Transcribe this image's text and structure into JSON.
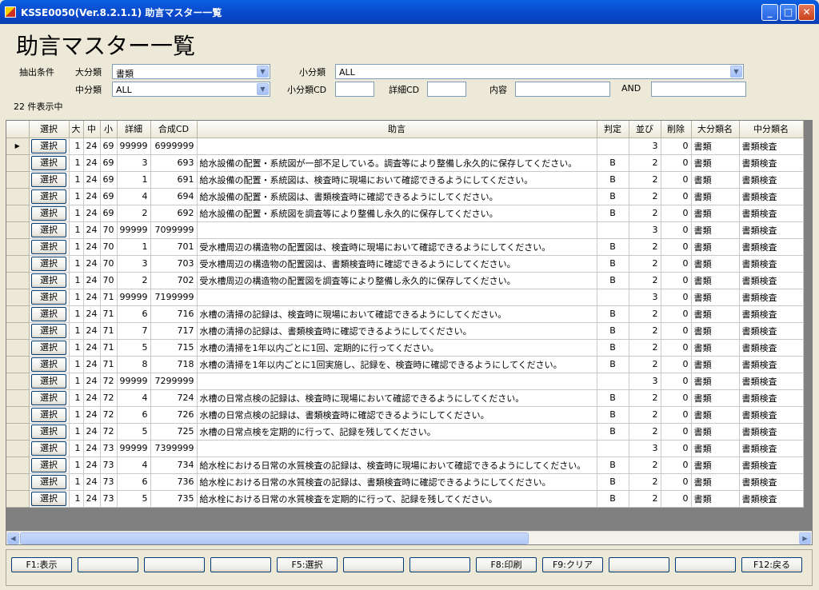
{
  "window": {
    "title": "KSSE0050(Ver.8.2.1.1) 助言マスター一覧"
  },
  "page_title": "助言マスター一覧",
  "filter": {
    "section_label": "抽出条件",
    "large_label": "大分類",
    "large_value": "書類",
    "small_label": "小分類",
    "small_value": "ALL",
    "middle_label": "中分類",
    "middle_value": "ALL",
    "small_cd_label": "小分類CD",
    "small_cd_value": "",
    "detail_cd_label": "詳細CD",
    "detail_cd_value": "",
    "content_label": "内容",
    "content_value": "",
    "and_label": "AND",
    "and_value": ""
  },
  "count_text": "22 件表示中",
  "table": {
    "columns": [
      "選択",
      "大",
      "中",
      "小",
      "詳細",
      "合成CD",
      "助言",
      "判定",
      "並び",
      "削除",
      "大分類名",
      "中分類名"
    ],
    "select_label": "選択",
    "rows": [
      [
        "1",
        "24",
        "69",
        "99999",
        "6999999",
        "",
        "",
        "3",
        "0",
        "書類",
        "書類検査"
      ],
      [
        "1",
        "24",
        "69",
        "3",
        "693",
        "給水設備の配置・系統図が一部不足している。調査等により整備し永久的に保存してください。",
        "B",
        "2",
        "0",
        "書類",
        "書類検査"
      ],
      [
        "1",
        "24",
        "69",
        "1",
        "691",
        "給水設備の配置・系統図は、検査時に現場において確認できるようにしてください。",
        "B",
        "2",
        "0",
        "書類",
        "書類検査"
      ],
      [
        "1",
        "24",
        "69",
        "4",
        "694",
        "給水設備の配置・系統図は、書類検査時に確認できるようにしてください。",
        "B",
        "2",
        "0",
        "書類",
        "書類検査"
      ],
      [
        "1",
        "24",
        "69",
        "2",
        "692",
        "給水設備の配置・系統図を調査等により整備し永久的に保存してください。",
        "B",
        "2",
        "0",
        "書類",
        "書類検査"
      ],
      [
        "1",
        "24",
        "70",
        "99999",
        "7099999",
        "",
        "",
        "3",
        "0",
        "書類",
        "書類検査"
      ],
      [
        "1",
        "24",
        "70",
        "1",
        "701",
        "受水槽周辺の構造物の配置図は、検査時に現場において確認できるようにしてください。",
        "B",
        "2",
        "0",
        "書類",
        "書類検査"
      ],
      [
        "1",
        "24",
        "70",
        "3",
        "703",
        "受水槽周辺の構造物の配置図は、書類検査時に確認できるようにしてください。",
        "B",
        "2",
        "0",
        "書類",
        "書類検査"
      ],
      [
        "1",
        "24",
        "70",
        "2",
        "702",
        "受水槽周辺の構造物の配置図を調査等により整備し永久的に保存してください。",
        "B",
        "2",
        "0",
        "書類",
        "書類検査"
      ],
      [
        "1",
        "24",
        "71",
        "99999",
        "7199999",
        "",
        "",
        "3",
        "0",
        "書類",
        "書類検査"
      ],
      [
        "1",
        "24",
        "71",
        "6",
        "716",
        "水槽の清掃の記録は、検査時に現場において確認できるようにしてください。",
        "B",
        "2",
        "0",
        "書類",
        "書類検査"
      ],
      [
        "1",
        "24",
        "71",
        "7",
        "717",
        "水槽の清掃の記録は、書類検査時に確認できるようにしてください。",
        "B",
        "2",
        "0",
        "書類",
        "書類検査"
      ],
      [
        "1",
        "24",
        "71",
        "5",
        "715",
        "水槽の清掃を1年以内ごとに1回、定期的に行ってください。",
        "B",
        "2",
        "0",
        "書類",
        "書類検査"
      ],
      [
        "1",
        "24",
        "71",
        "8",
        "718",
        "水槽の清掃を1年以内ごとに1回実施し、記録を、検査時に確認できるようにしてください。",
        "B",
        "2",
        "0",
        "書類",
        "書類検査"
      ],
      [
        "1",
        "24",
        "72",
        "99999",
        "7299999",
        "",
        "",
        "3",
        "0",
        "書類",
        "書類検査"
      ],
      [
        "1",
        "24",
        "72",
        "4",
        "724",
        "水槽の日常点検の記録は、検査時に現場において確認できるようにしてください。",
        "B",
        "2",
        "0",
        "書類",
        "書類検査"
      ],
      [
        "1",
        "24",
        "72",
        "6",
        "726",
        "水槽の日常点検の記録は、書類検査時に確認できるようにしてください。",
        "B",
        "2",
        "0",
        "書類",
        "書類検査"
      ],
      [
        "1",
        "24",
        "72",
        "5",
        "725",
        "水槽の日常点検を定期的に行って、記録を残してください。",
        "B",
        "2",
        "0",
        "書類",
        "書類検査"
      ],
      [
        "1",
        "24",
        "73",
        "99999",
        "7399999",
        "",
        "",
        "3",
        "0",
        "書類",
        "書類検査"
      ],
      [
        "1",
        "24",
        "73",
        "4",
        "734",
        "給水栓における日常の水質検査の記録は、検査時に現場において確認できるようにしてください。",
        "B",
        "2",
        "0",
        "書類",
        "書類検査"
      ],
      [
        "1",
        "24",
        "73",
        "6",
        "736",
        "給水栓における日常の水質検査の記録は、書類検査時に確認できるようにしてください。",
        "B",
        "2",
        "0",
        "書類",
        "書類検査"
      ],
      [
        "1",
        "24",
        "73",
        "5",
        "735",
        "給水栓における日常の水質検査を定期的に行って、記録を残してください。",
        "B",
        "2",
        "0",
        "書類",
        "書類検査"
      ]
    ]
  },
  "fkeys": [
    "F1:表示",
    "",
    "",
    "",
    "F5:選択",
    "",
    "",
    "F8:印刷",
    "F9:クリア",
    "",
    "",
    "F12:戻る"
  ]
}
